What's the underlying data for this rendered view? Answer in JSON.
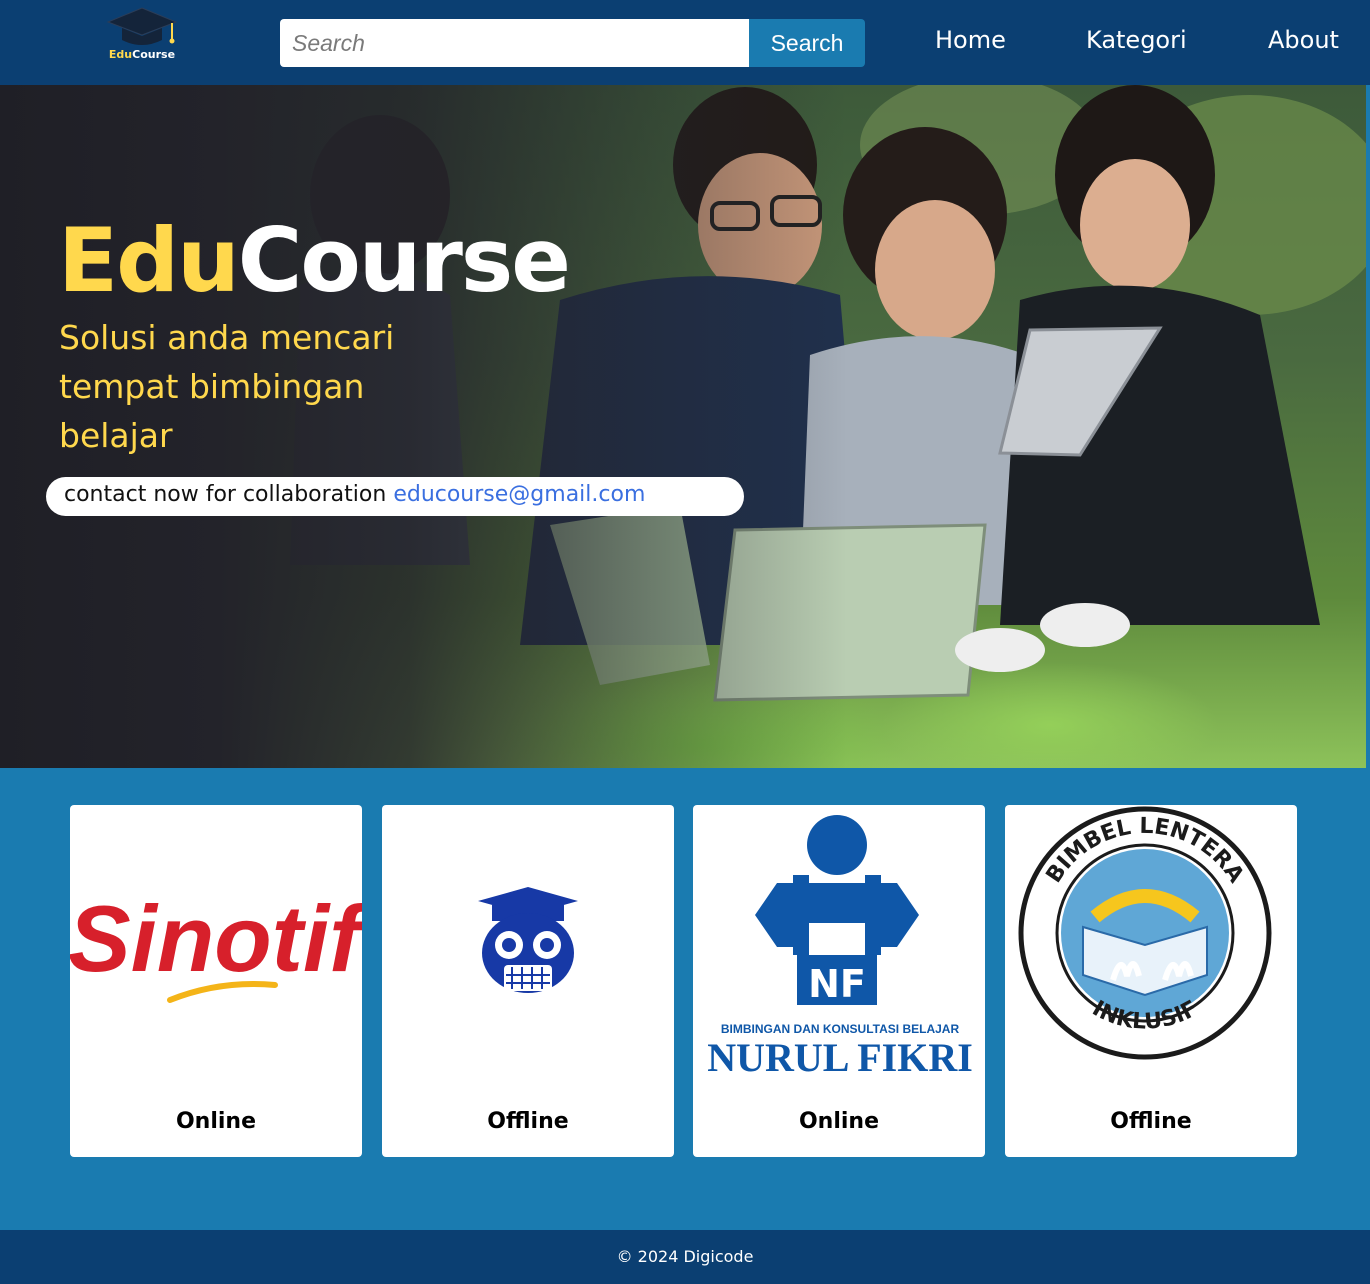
{
  "navbar": {
    "logo": {
      "icon": "graduation-cap-icon",
      "text_edu": "Edu",
      "text_course": "Course"
    },
    "search": {
      "placeholder": "Search",
      "value": "",
      "button_label": "Search"
    },
    "links": [
      {
        "label": "Home"
      },
      {
        "label": "Kategori"
      },
      {
        "label": "About"
      }
    ]
  },
  "hero": {
    "title_edu": "Edu",
    "title_course": "Course",
    "subtitle": "Solusi anda mencari tempat bimbingan belajar",
    "contact_text": "contact now for collaboration",
    "contact_email": "educourse@gmail.com"
  },
  "cards": [
    {
      "logo_text": "Sinotif",
      "logo_name": "sinotif-logo",
      "mode": "Online"
    },
    {
      "logo_name": "owl-graduate-logo",
      "mode": "Offline"
    },
    {
      "logo_caption": "BIMBINGAN DAN KONSULTASI BELAJAR",
      "logo_title": "NURUL FIKRI",
      "logo_mark": "NF",
      "logo_name": "nurul-fikri-logo",
      "mode": "Online"
    },
    {
      "logo_ring_top": "BIMBEL LENTERA",
      "logo_ring_bottom": "INKLUSIF",
      "logo_name": "bimbel-lentera-logo",
      "mode": "Offline"
    }
  ],
  "footer": {
    "text": "© 2024 Digicode"
  },
  "colors": {
    "navbar_bg": "#0b3f72",
    "page_bg": "#1a7bb0",
    "accent_yellow": "#ffd84d",
    "email_link": "#3a6fe0"
  }
}
